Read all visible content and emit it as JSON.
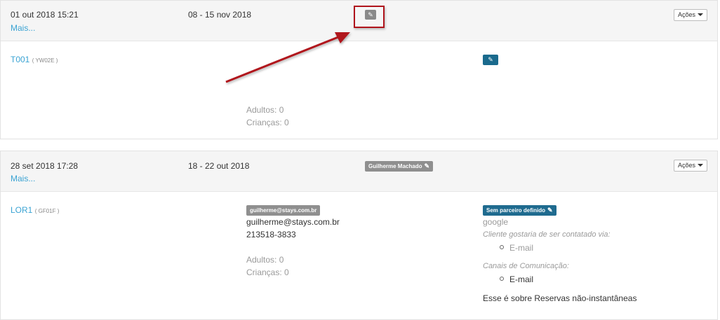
{
  "reservations": [
    {
      "created": "01 out 2018 15:21",
      "more": "Mais...",
      "dates": "08 - 15 nov 2018",
      "actions": "Ações",
      "unit": "T001",
      "unit_code": "( YW02E )",
      "adults": "Adultos: 0",
      "children": "Crianças: 0"
    },
    {
      "created": "28 set 2018 17:28",
      "more": "Mais...",
      "dates": "18 - 22 out 2018",
      "agent_tag": "Guilherme Machado",
      "actions": "Ações",
      "unit": "LOR1",
      "unit_code": "( GF01F )",
      "email_tag": "guilherme@stays.com.br",
      "email": "guilherme@stays.com.br",
      "phone": "213518-3833",
      "adults": "Adultos: 0",
      "children": "Crianças: 0",
      "partner_tag": "Sem parceiro definido",
      "source": "google",
      "contact_pref_label": "Cliente gostaria de ser contatado via:",
      "contact_pref_item": "E-mail",
      "channels_label": "Canais de Comunicação:",
      "channels_item": "E-mail",
      "note": "Esse é sobre Reservas não-instantâneas"
    }
  ],
  "icons": {
    "edit": "pencil-icon",
    "dropdown": "caret-down-icon"
  },
  "colors": {
    "accent_link": "#3aa3d3",
    "annotation_red": "#b0141c",
    "tag_blue": "#1f6b8f",
    "tag_grey": "#8f8f8f"
  }
}
